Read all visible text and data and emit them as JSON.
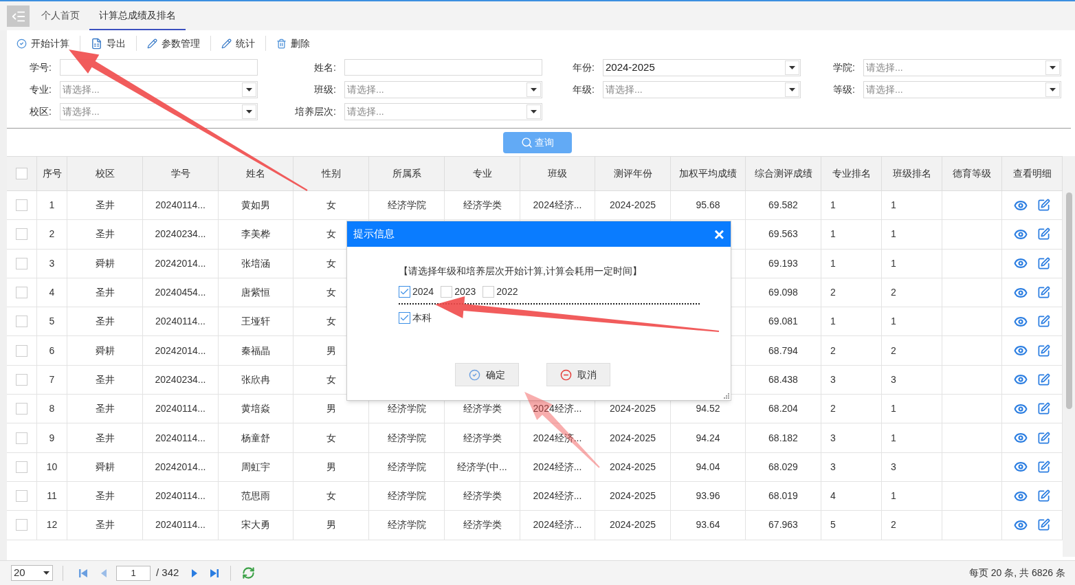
{
  "tabs": [
    {
      "label": "个人首页",
      "selected": false
    },
    {
      "label": "计算总成绩及排名",
      "selected": true
    }
  ],
  "toolbar": [
    {
      "label": "开始计算",
      "kind": "start"
    },
    {
      "label": "导出",
      "kind": "export"
    },
    {
      "label": "参数管理",
      "kind": "edit"
    },
    {
      "label": "统计",
      "kind": "edit"
    },
    {
      "label": "删除",
      "kind": "delete"
    }
  ],
  "filters": [
    {
      "label": "学号:",
      "kind": "text"
    },
    {
      "label": "姓名:",
      "kind": "text"
    },
    {
      "label": "年份:",
      "kind": "select",
      "value": "2024-2025"
    },
    {
      "label": "学院:",
      "kind": "select",
      "placeholder": "请选择..."
    },
    {
      "label": "专业:",
      "kind": "select",
      "placeholder": "请选择..."
    },
    {
      "label": "班级:",
      "kind": "select",
      "placeholder": "请选择..."
    },
    {
      "label": "年级:",
      "kind": "select",
      "placeholder": "请选择..."
    },
    {
      "label": "等级:",
      "kind": "select",
      "placeholder": "请选择..."
    },
    {
      "label": "校区:",
      "kind": "select",
      "placeholder": "请选择..."
    },
    {
      "label": "培养层次:",
      "kind": "select",
      "placeholder": "请选择..."
    }
  ],
  "query_button": "查询",
  "table": {
    "all_checked": false,
    "columns": [
      "序号",
      "校区",
      "学号",
      "姓名",
      "性别",
      "所属系",
      "专业",
      "班级",
      "测评年份",
      "加权平均成绩",
      "综合测评成绩",
      "专业排名",
      "班级排名",
      "德育等级",
      "查看明细"
    ],
    "rows": [
      {
        "checked": false,
        "cells": [
          "1",
          "圣井",
          "20240114...",
          "黄如男",
          "女",
          "经济学院",
          "经济学类",
          "2024经济...",
          "2024-2025",
          "95.68",
          "69.582",
          "1",
          "1",
          null
        ]
      },
      {
        "checked": false,
        "cells": [
          "2",
          "圣井",
          "20240234...",
          "李美桦",
          "女",
          null,
          null,
          null,
          null,
          null,
          "69.563",
          "1",
          "1",
          null
        ]
      },
      {
        "checked": false,
        "cells": [
          "3",
          "舜耕",
          "20242014...",
          "张培涵",
          "女",
          null,
          null,
          null,
          null,
          null,
          "69.193",
          "1",
          "1",
          null
        ]
      },
      {
        "checked": false,
        "cells": [
          "4",
          "圣井",
          "20240454...",
          "唐紫恒",
          "女",
          null,
          null,
          null,
          null,
          null,
          "69.098",
          "2",
          "2",
          null
        ]
      },
      {
        "checked": false,
        "cells": [
          "5",
          "圣井",
          "20240114...",
          "王垭轩",
          "女",
          null,
          null,
          null,
          null,
          null,
          "69.081",
          "1",
          "1",
          null
        ]
      },
      {
        "checked": false,
        "cells": [
          "6",
          "舜耕",
          "20242014...",
          "秦福晶",
          "男",
          null,
          null,
          null,
          null,
          null,
          "68.794",
          "2",
          "2",
          null
        ]
      },
      {
        "checked": false,
        "cells": [
          "7",
          "圣井",
          "20240234...",
          "张欣冉",
          "女",
          null,
          null,
          null,
          null,
          null,
          "68.438",
          "3",
          "3",
          null
        ]
      },
      {
        "checked": false,
        "cells": [
          "8",
          "圣井",
          "20240114...",
          "黄培焱",
          "男",
          "经济学院",
          "经济学类",
          "2024经济...",
          "2024-2025",
          "94.52",
          "68.204",
          "2",
          "1",
          null
        ]
      },
      {
        "checked": false,
        "cells": [
          "9",
          "圣井",
          "20240114...",
          "杨童舒",
          "女",
          "经济学院",
          "经济学类",
          "2024经济...",
          "2024-2025",
          "94.24",
          "68.182",
          "3",
          "1",
          null
        ]
      },
      {
        "checked": false,
        "cells": [
          "10",
          "舜耕",
          "20242014...",
          "周虹宇",
          "男",
          "经济学院",
          "经济学(中...",
          "2024经济...",
          "2024-2025",
          "94.04",
          "68.029",
          "3",
          "3",
          null
        ]
      },
      {
        "checked": false,
        "cells": [
          "11",
          "圣井",
          "20240114...",
          "范思雨",
          "女",
          "经济学院",
          "经济学类",
          "2024经济...",
          "2024-2025",
          "93.96",
          "68.019",
          "4",
          "1",
          null
        ]
      },
      {
        "checked": false,
        "cells": [
          "12",
          "圣井",
          "20240114...",
          "宋大勇",
          "男",
          "经济学院",
          "经济学类",
          "2024经济...",
          "2024-2025",
          "93.64",
          "67.963",
          "5",
          "2",
          null
        ]
      }
    ]
  },
  "dialog": {
    "title": "提示信息",
    "close": "×",
    "message": "【请选择年级和培养层次开始计算,计算会耗用一定时间】",
    "grades": [
      {
        "label": "2024",
        "checked": true
      },
      {
        "label": "2023",
        "checked": false
      },
      {
        "label": "2022",
        "checked": false
      }
    ],
    "levels": [
      {
        "label": "本科",
        "checked": true
      }
    ],
    "buttons": [
      {
        "label": "确定",
        "kind": "confirm"
      },
      {
        "label": "取消",
        "kind": "cancel"
      }
    ]
  },
  "pagination": {
    "page_size": "20",
    "page": "1",
    "total_pages": "/ 342",
    "summary": "每页 20 条, 共 6826 条"
  }
}
